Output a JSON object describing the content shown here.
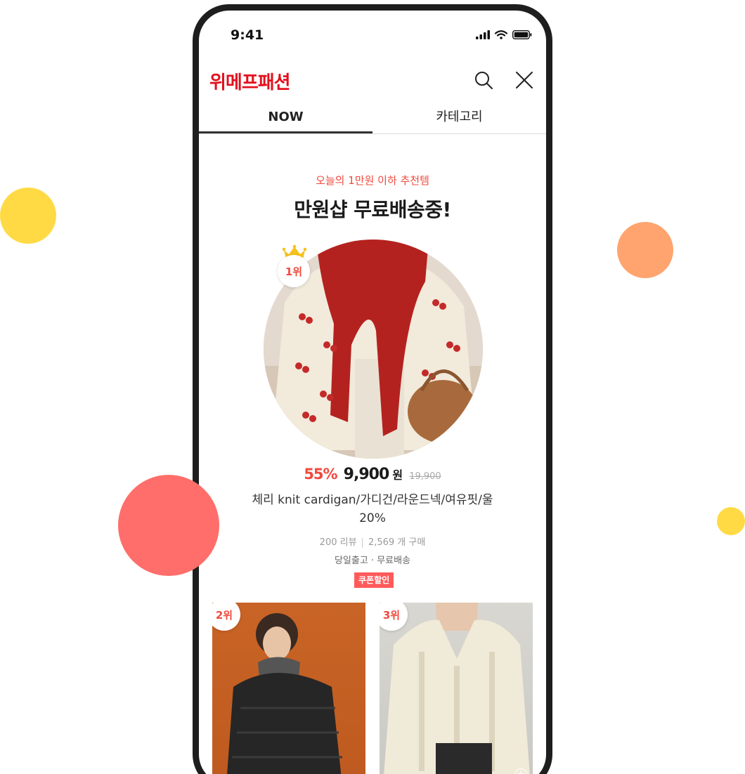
{
  "status_bar": {
    "time": "9:41"
  },
  "header": {
    "brand": "위메프패션",
    "icons": [
      "search-icon",
      "close-icon"
    ]
  },
  "tabs": [
    {
      "label": "NOW",
      "active": true
    },
    {
      "label": "카테고리",
      "active": false
    }
  ],
  "promo": {
    "subtitle": "오늘의 1만원 이하 추천템",
    "headline": "만원샵 무료배송중!"
  },
  "featured": {
    "rank": "1위",
    "discount": "55%",
    "price": "9,900",
    "currency": "원",
    "original_price": "19,900",
    "name": "체리 knit cardigan/가디건/라운드넥/여유핏/울20%",
    "reviews": "200 리뷰",
    "purchases": "2,569 개 구매",
    "shipping": "당일출고 · 무료배송",
    "badge": "쿠폰할인"
  },
  "cards": [
    {
      "rank": "2위"
    },
    {
      "rank": "3위"
    }
  ],
  "colors": {
    "brand": "#E3101E",
    "accent": "#F04A3E",
    "coupon_bg": "#FF5A5A"
  }
}
